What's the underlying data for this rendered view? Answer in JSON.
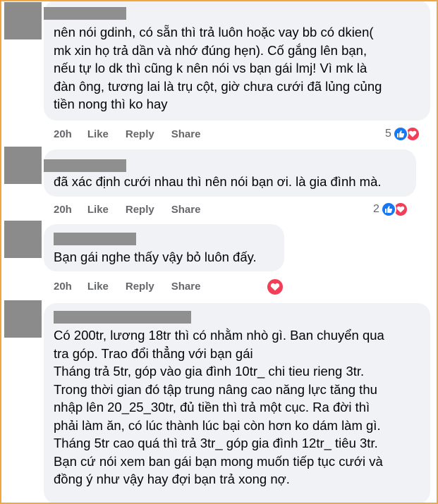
{
  "comments": [
    {
      "text": "nên nói gdinh, có sẵn thì trả luôn hoặc vay bb có dkien(\nmk xin họ trả dần và nhớ đúng hẹn). Cố gắng lên bạn,\nnếu tự lo dk thì cũng k nên nói vs bạn gái lmj! Vì mk là\nđàn ông, tương lai là trụ cột, giờ chưa cưới đã lủng củng\ntiền nong thì ko hay",
      "time": "20h",
      "like": "Like",
      "reply": "Reply",
      "share": "Share",
      "reaction_count": "5",
      "reactions": [
        "like-icon",
        "love-icon"
      ]
    },
    {
      "text": "đã xác định cưới nhau thì nên nói bạn ơi. là gia đình mà.",
      "time": "20h",
      "like": "Like",
      "reply": "Reply",
      "share": "Share",
      "reaction_count": "2",
      "reactions": [
        "like-icon",
        "love-icon"
      ]
    },
    {
      "text": "Bạn gái nghe thấy vậy bỏ luôn đấy.",
      "time": "20h",
      "like": "Like",
      "reply": "Reply",
      "share": "Share",
      "reaction_count": "",
      "reactions": [
        "love-icon"
      ]
    },
    {
      "text": "Có 200tr, lương 18tr thì có nhằm nhò gì. Ban chuyển qua\ntra góp. Trao đổi thẳng với bạn gái\nTháng trả 5tr, góp vào gia đình 10tr_ chi tieu rieng 3tr.\nTrong thời gian đó tập trung nâng cao năng lực tăng thu\nnhập lên 20_25_30tr, đủ tiền thì trả một cục. Ra đời thì\nphải làm ăn, có lúc thành lúc bại còn hơn ko dám làm gì.\nTháng 5tr cao quá thì trả 3tr_ góp gia đình 12tr_ tiêu 3tr.\nBạn cứ nói xem ban gái bạn mong muốn tiếp tục cưới và\nđồng ý như vậy hay đợi bạn trả xong nợ."
    }
  ],
  "colors": {
    "bubble": "#f0f2f5",
    "like": "#1877f2",
    "love": "#f33e58",
    "meta": "#65676b",
    "border": "#f2a640"
  }
}
